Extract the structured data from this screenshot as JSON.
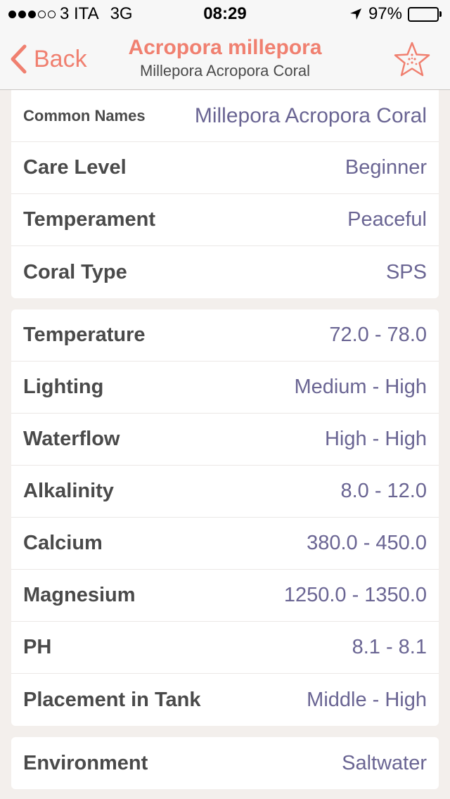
{
  "status_bar": {
    "carrier": "3 ITA",
    "network": "3G",
    "time": "08:29",
    "battery": "97%",
    "battery_level": 0.97,
    "signal_bars_filled": 3,
    "signal_bars_total": 5
  },
  "nav": {
    "back_label": "Back",
    "title": "Acropora millepora",
    "subtitle": "Millepora Acropora Coral",
    "favorite_icon": "star-icon",
    "accent_color": "#f08070"
  },
  "section1": [
    {
      "label": "Common Names",
      "value": "Millepora Acropora Coral"
    },
    {
      "label": "Care Level",
      "value": "Beginner"
    },
    {
      "label": "Temperament",
      "value": "Peaceful"
    },
    {
      "label": "Coral Type",
      "value": "SPS"
    }
  ],
  "section2": [
    {
      "label": "Temperature",
      "value": "72.0 - 78.0"
    },
    {
      "label": "Lighting",
      "value": "Medium - High"
    },
    {
      "label": "Waterflow",
      "value": "High - High"
    },
    {
      "label": "Alkalinity",
      "value": "8.0 - 12.0"
    },
    {
      "label": "Calcium",
      "value": "380.0 - 450.0"
    },
    {
      "label": "Magnesium",
      "value": "1250.0 - 1350.0"
    },
    {
      "label": "PH",
      "value": "8.1 - 8.1"
    },
    {
      "label": "Placement in Tank",
      "value": "Middle - High"
    }
  ],
  "section3": [
    {
      "label": "Environment",
      "value": "Saltwater"
    }
  ],
  "colors": {
    "value_text": "#6a6593",
    "label_text": "#4a4a4a",
    "background": "#f3efec"
  }
}
